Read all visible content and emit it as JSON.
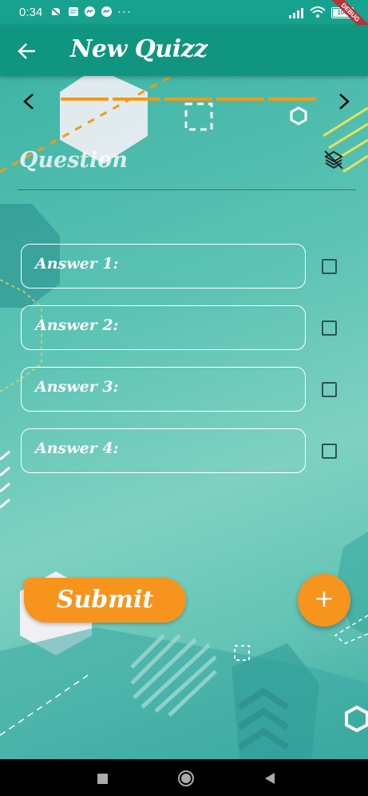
{
  "status_bar": {
    "time": "0:34",
    "battery": "100",
    "debug_banner": "DEBUG"
  },
  "app_bar": {
    "title": "New Quizz"
  },
  "quiz": {
    "question_placeholder": "Question",
    "answers": [
      "Answer 1:",
      "Answer 2:",
      "Answer 3:",
      "Answer 4:"
    ],
    "progress_segments": 5
  },
  "actions": {
    "submit_label": "Submit",
    "add_label": "+"
  },
  "icons": {
    "back": "arrow-left-icon",
    "prev": "chevron-left-icon",
    "next": "chevron-right-icon",
    "layers": "layers-off-icon",
    "add": "plus-icon"
  },
  "colors": {
    "primary": "#0f9580",
    "accent": "#f7941d",
    "background": "#5cc3b4"
  }
}
